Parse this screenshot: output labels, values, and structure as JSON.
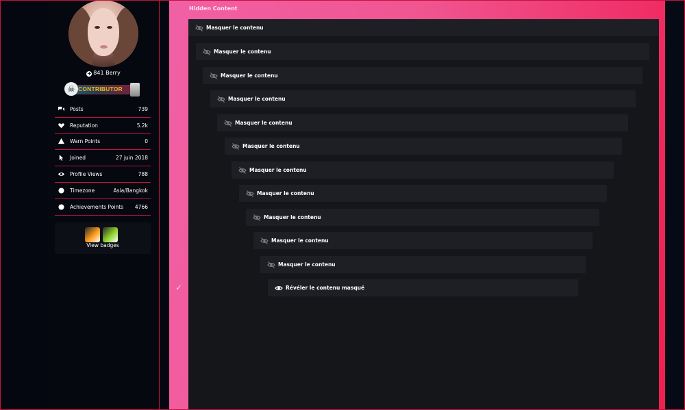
{
  "profile": {
    "berry": "841 Berry",
    "rank_badge": "CONTRIBUTOR",
    "stats": [
      {
        "icon": "comments-icon",
        "label": "Posts",
        "value": "739"
      },
      {
        "icon": "heart-icon",
        "label": "Reputation",
        "value": "5.2k"
      },
      {
        "icon": "warning-icon",
        "label": "Warn Points",
        "value": "0"
      },
      {
        "icon": "cursor-icon",
        "label": "Joined",
        "value": "27 juin 2018"
      },
      {
        "icon": "eye-icon",
        "label": "Profile Views",
        "value": "788"
      },
      {
        "icon": "globe-icon",
        "label": "Timezone",
        "value": "Asia/Bangkok"
      },
      {
        "icon": "trophy-icon",
        "label": "Achievements Points",
        "value": "4766"
      }
    ],
    "view_badges": "View badges"
  },
  "panel": {
    "title": "Hidden Content",
    "hide_label": "Masquer le contenu",
    "reveal_label": "Révéler le contenu masqué",
    "rows": [
      "Masquer le contenu",
      "Masquer le contenu",
      "Masquer le contenu",
      "Masquer le contenu",
      "Masquer le contenu",
      "Masquer le contenu",
      "Masquer le contenu",
      "Masquer le contenu",
      "Masquer le contenu",
      "Masquer le contenu",
      "Masquer le contenu"
    ]
  },
  "colors": {
    "accent": "#c21440",
    "panel_gradient_start": "#f160a5",
    "panel_gradient_end": "#ee1f4f",
    "inner_bg": "#15161a",
    "row_bg": "#1e1f24"
  }
}
